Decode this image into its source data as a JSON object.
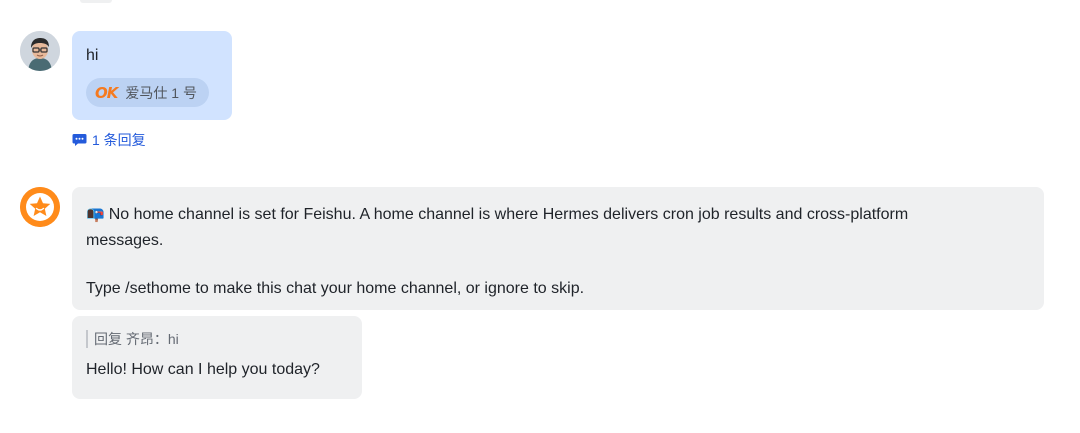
{
  "messages": {
    "user": {
      "avatar_icon": "user-photo-avatar",
      "text": "hi",
      "ack": {
        "icon": "ok-icon",
        "icon_text": "OK",
        "name": "爱马仕 1 号"
      },
      "thread": {
        "icon": "comment-icon",
        "label": "1 条回复"
      }
    },
    "bot_notice": {
      "avatar_icon": "star-bot-avatar",
      "emoji": "📭",
      "line1": "No home channel is set for Feishu. A home channel is where Hermes delivers cron job results and cross-platform",
      "line2": "messages.",
      "line3": "Type /sethome to make this chat your home channel, or ignore to skip."
    },
    "bot_reply": {
      "quote": "回复 齐昂：hi",
      "text": "Hello! How can I help you today?"
    }
  },
  "colors": {
    "user_bubble": "#d1e3ff",
    "bot_bubble": "#eff0f1",
    "link_blue": "#245bdb",
    "ok_orange": "#f57a1f",
    "bot_avatar": "#ff8b1a"
  }
}
